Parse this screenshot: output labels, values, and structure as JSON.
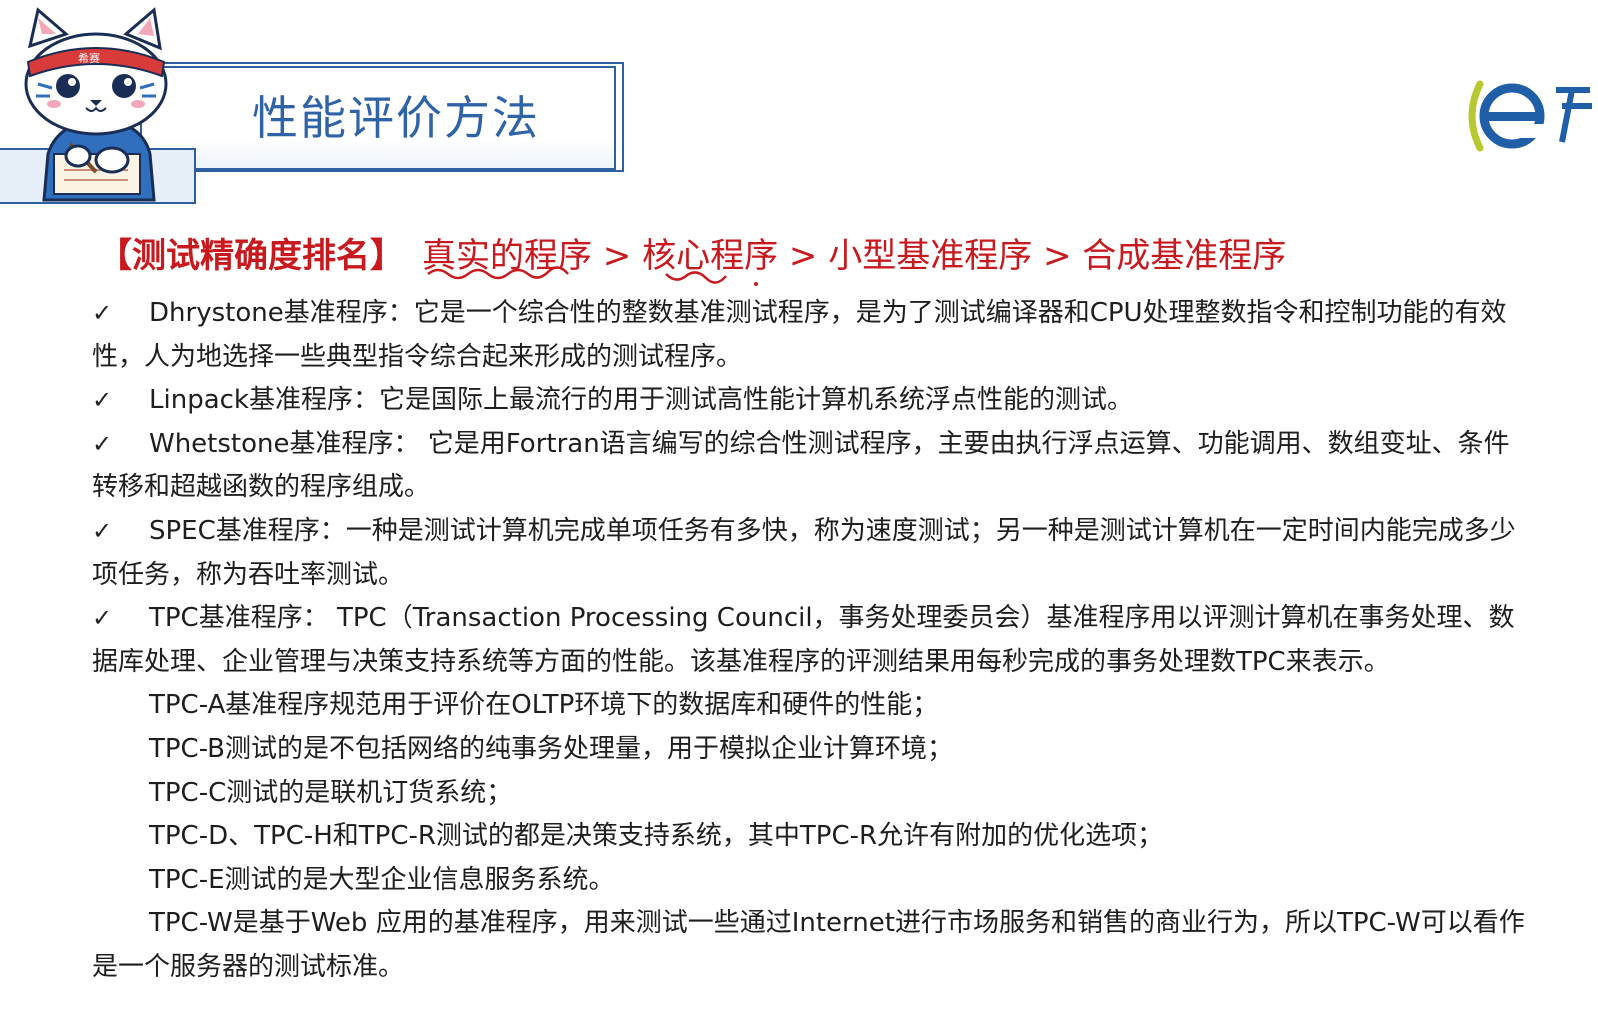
{
  "header": {
    "title": "性能评价方法",
    "mascot_badge": "希赛"
  },
  "ranking": {
    "label": "【测试精确度排名】",
    "sequence": "真实的程序 > 核心程序 > 小型基准程序 > 合成基准程序"
  },
  "items": [
    {
      "check": "✓",
      "text": "Dhrystone基准程序：它是一个综合性的整数基准测试程序，是为了测试编译器和CPU处理整数指令和控制功能的有效性，人为地选择一些典型指令综合起来形成的测试程序。"
    },
    {
      "check": "✓",
      "text": "Linpack基准程序：它是国际上最流行的用于测试高性能计算机系统浮点性能的测试。"
    },
    {
      "check": "✓",
      "text": "Whetstone基准程序： 它是用Fortran语言编写的综合性测试程序，主要由执行浮点运算、功能调用、数组变址、条件转移和超越函数的程序组成。"
    },
    {
      "check": "✓",
      "text": "SPEC基准程序：一种是测试计算机完成单项任务有多快，称为速度测试；另一种是测试计算机在一定时间内能完成多少项任务，称为吞吐率测试。"
    },
    {
      "check": "✓",
      "text": "TPC基准程序： TPC（Transaction Processing Council，事务处理委员会）基准程序用以评测计算机在事务处理、数据库处理、企业管理与决策支持系统等方面的性能。该基准程序的评测结果用每秒完成的事务处理数TPC来表示。"
    }
  ],
  "tpc_subitems": [
    "TPC-A基准程序规范用于评价在OLTP环境下的数据库和硬件的性能；",
    "TPC-B测试的是不包括网络的纯事务处理量，用于模拟企业计算环境；",
    "TPC-C测试的是联机订货系统；",
    "TPC-D、TPC-H和TPC-R测试的都是决策支持系统，其中TPC-R允许有附加的优化选项；",
    "TPC-E测试的是大型企业信息服务系统。"
  ],
  "tpc_w": "TPC-W是基于Web 应用的基准程序，用来测试一些通过Internet进行市场服务和销售的商业行为，所以TPC-W可以看作是一个服务器的测试标准。",
  "colors": {
    "title_blue": "#2e63a8",
    "ranking_red": "#c8191e",
    "frame_blue": "#2e5fa3"
  },
  "icons": [
    "cat-mascot-icon",
    "company-logo-icon",
    "checkmark-icon"
  ]
}
